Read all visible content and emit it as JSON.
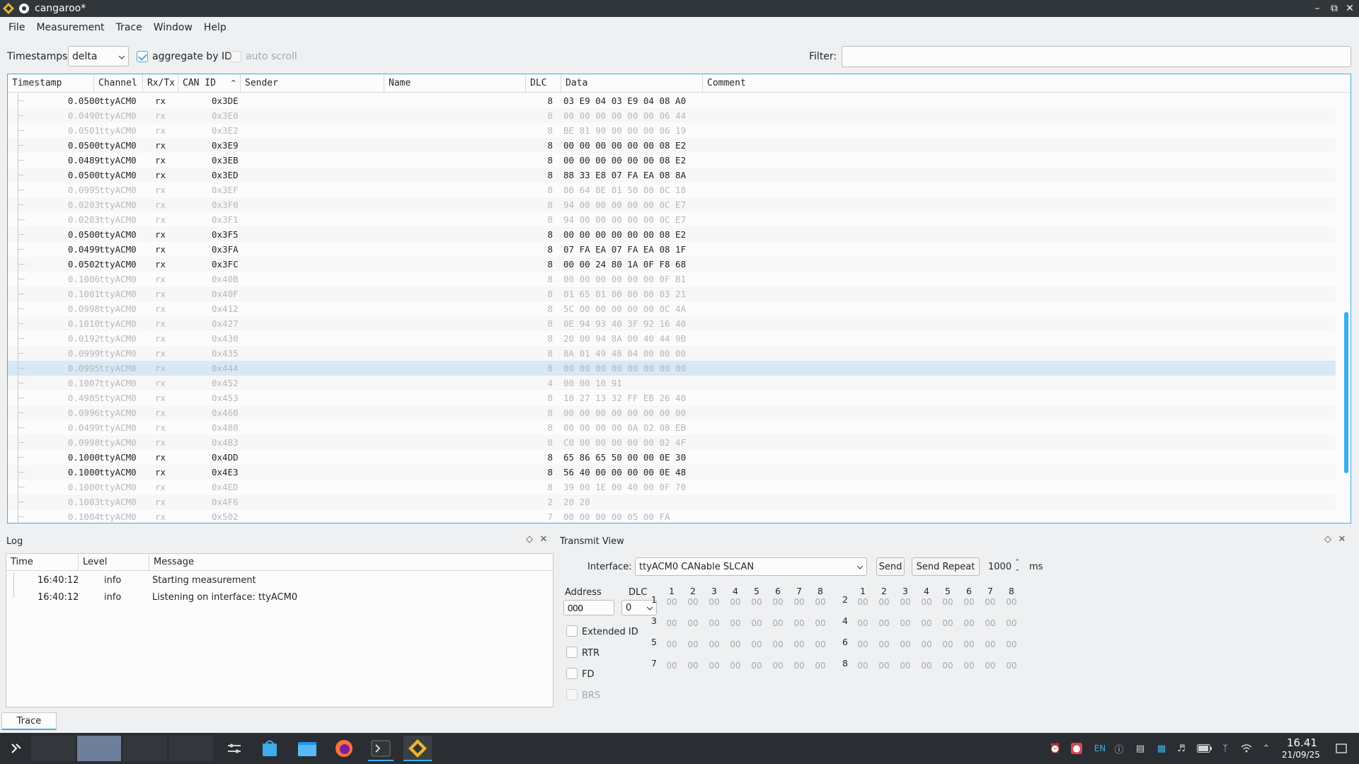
{
  "window": {
    "title": "cangaroo*"
  },
  "menu": [
    "File",
    "Measurement",
    "Trace",
    "Window",
    "Help"
  ],
  "toolbar": {
    "timestamps_label": "Timestamps:",
    "timestamps_value": "delta",
    "aggregate_label": "aggregate by ID",
    "aggregate_checked": true,
    "autoscroll_label": "auto scroll",
    "autoscroll_checked": false,
    "filter_label": "Filter:",
    "filter_value": ""
  },
  "trace": {
    "columns": [
      "Timestamp",
      "Channel",
      "Rx/Tx",
      "CAN ID",
      "Sender",
      "Name",
      "DLC",
      "Data",
      "Comment"
    ],
    "rows": [
      {
        "ts": "0.0500",
        "ch": "ttyACM0",
        "dir": "rx",
        "id": "0x3DE",
        "dlc": "8",
        "data": "03 E9 04 03 E9 04 08 A0",
        "dim": false
      },
      {
        "ts": "0.0490",
        "ch": "ttyACM0",
        "dir": "rx",
        "id": "0x3E0",
        "dlc": "8",
        "data": "00 00 00 00 00 00 06 44",
        "dim": true
      },
      {
        "ts": "0.0501",
        "ch": "ttyACM0",
        "dir": "rx",
        "id": "0x3E2",
        "dlc": "8",
        "data": "BE 81 90 00 00 00 06 19",
        "dim": true
      },
      {
        "ts": "0.0500",
        "ch": "ttyACM0",
        "dir": "rx",
        "id": "0x3E9",
        "dlc": "8",
        "data": "00 00 00 00 00 00 08 E2",
        "dim": false
      },
      {
        "ts": "0.0489",
        "ch": "ttyACM0",
        "dir": "rx",
        "id": "0x3EB",
        "dlc": "8",
        "data": "00 00 00 00 00 00 08 E2",
        "dim": false
      },
      {
        "ts": "0.0500",
        "ch": "ttyACM0",
        "dir": "rx",
        "id": "0x3ED",
        "dlc": "8",
        "data": "88 33 E8 07 FA EA 08 8A",
        "dim": false
      },
      {
        "ts": "0.0995",
        "ch": "ttyACM0",
        "dir": "rx",
        "id": "0x3EF",
        "dlc": "8",
        "data": "00 64 0E 01 50 00 0C 18",
        "dim": true
      },
      {
        "ts": "0.0203",
        "ch": "ttyACM0",
        "dir": "rx",
        "id": "0x3F0",
        "dlc": "8",
        "data": "94 00 00 00 00 00 0C E7",
        "dim": true
      },
      {
        "ts": "0.0203",
        "ch": "ttyACM0",
        "dir": "rx",
        "id": "0x3F1",
        "dlc": "8",
        "data": "94 00 00 00 00 00 0C E7",
        "dim": true
      },
      {
        "ts": "0.0500",
        "ch": "ttyACM0",
        "dir": "rx",
        "id": "0x3F5",
        "dlc": "8",
        "data": "00 00 00 00 00 00 08 E2",
        "dim": false
      },
      {
        "ts": "0.0499",
        "ch": "ttyACM0",
        "dir": "rx",
        "id": "0x3FA",
        "dlc": "8",
        "data": "07 FA EA 07 FA EA 08 1F",
        "dim": false
      },
      {
        "ts": "0.0502",
        "ch": "ttyACM0",
        "dir": "rx",
        "id": "0x3FC",
        "dlc": "8",
        "data": "00 00 24 80 1A 0F F8 68",
        "dim": false
      },
      {
        "ts": "0.1006",
        "ch": "ttyACM0",
        "dir": "rx",
        "id": "0x40B",
        "dlc": "8",
        "data": "00 00 00 00 00 00 0F B1",
        "dim": true
      },
      {
        "ts": "0.1001",
        "ch": "ttyACM0",
        "dir": "rx",
        "id": "0x40F",
        "dlc": "8",
        "data": "01 65 01 00 00 00 03 21",
        "dim": true
      },
      {
        "ts": "0.0998",
        "ch": "ttyACM0",
        "dir": "rx",
        "id": "0x412",
        "dlc": "8",
        "data": "5C 00 00 00 00 00 0C 4A",
        "dim": true
      },
      {
        "ts": "0.1010",
        "ch": "ttyACM0",
        "dir": "rx",
        "id": "0x427",
        "dlc": "8",
        "data": "0E 94 93 40 3F 92 16 40",
        "dim": true
      },
      {
        "ts": "0.0192",
        "ch": "ttyACM0",
        "dir": "rx",
        "id": "0x430",
        "dlc": "8",
        "data": "20 00 94 8A 00 40 44 9B",
        "dim": true
      },
      {
        "ts": "0.0999",
        "ch": "ttyACM0",
        "dir": "rx",
        "id": "0x435",
        "dlc": "8",
        "data": "8A 01 49 48 04 00 00 00",
        "dim": true
      },
      {
        "ts": "0.0995",
        "ch": "ttyACM0",
        "dir": "rx",
        "id": "0x444",
        "dlc": "8",
        "data": "00 00 00 00 00 00 00 00",
        "dim": true,
        "sel": true
      },
      {
        "ts": "0.1007",
        "ch": "ttyACM0",
        "dir": "rx",
        "id": "0x452",
        "dlc": "4",
        "data": "00 00 10 91",
        "dim": true
      },
      {
        "ts": "0.4985",
        "ch": "ttyACM0",
        "dir": "rx",
        "id": "0x453",
        "dlc": "8",
        "data": "10 27 13 32 FF EB 26 40",
        "dim": true
      },
      {
        "ts": "0.0996",
        "ch": "ttyACM0",
        "dir": "rx",
        "id": "0x460",
        "dlc": "8",
        "data": "00 00 00 00 00 00 00 00",
        "dim": true
      },
      {
        "ts": "0.0499",
        "ch": "ttyACM0",
        "dir": "rx",
        "id": "0x480",
        "dlc": "8",
        "data": "00 00 00 00 0A 02 08 EB",
        "dim": true
      },
      {
        "ts": "0.0998",
        "ch": "ttyACM0",
        "dir": "rx",
        "id": "0x4B3",
        "dlc": "8",
        "data": "C0 00 00 00 00 00 02 4F",
        "dim": true
      },
      {
        "ts": "0.1000",
        "ch": "ttyACM0",
        "dir": "rx",
        "id": "0x4DD",
        "dlc": "8",
        "data": "65 86 65 50 00 00 0E 30",
        "dim": false
      },
      {
        "ts": "0.1000",
        "ch": "ttyACM0",
        "dir": "rx",
        "id": "0x4E3",
        "dlc": "8",
        "data": "56 40 00 00 00 00 0E 48",
        "dim": false
      },
      {
        "ts": "0.1000",
        "ch": "ttyACM0",
        "dir": "rx",
        "id": "0x4ED",
        "dlc": "8",
        "data": "39 00 1E 00 40 00 0F 70",
        "dim": true
      },
      {
        "ts": "0.1003",
        "ch": "ttyACM0",
        "dir": "rx",
        "id": "0x4F6",
        "dlc": "2",
        "data": "20 20",
        "dim": true
      },
      {
        "ts": "0.1004",
        "ch": "ttyACM0",
        "dir": "rx",
        "id": "0x502",
        "dlc": "7",
        "data": "00 00 00 00 05 00 FA",
        "dim": true
      }
    ]
  },
  "log": {
    "title": "Log",
    "columns": [
      "Time",
      "Level",
      "Message"
    ],
    "rows": [
      {
        "time": "16:40:12",
        "level": "info",
        "message": "Starting measurement"
      },
      {
        "time": "16:40:12",
        "level": "info",
        "message": "Listening on interface: ttyACM0"
      }
    ]
  },
  "transmit": {
    "title": "Transmit View",
    "interface_label": "Interface:",
    "interface_value": "ttyACM0 CANable SLCAN",
    "send_label": "Send",
    "send_repeat_label": "Send Repeat",
    "repeat_value": "1000",
    "repeat_unit": "ms",
    "address_label": "Address",
    "address_value": "000",
    "dlc_label": "DLC",
    "dlc_value": "0",
    "extended_label": "Extended ID",
    "rtr_label": "RTR",
    "fd_label": "FD",
    "brs_label": "BRS",
    "col_numbers": [
      "1",
      "2",
      "3",
      "4",
      "5",
      "6",
      "7",
      "8"
    ],
    "row_numbers": [
      "1",
      "2",
      "3",
      "4",
      "5",
      "6",
      "7",
      "8"
    ],
    "byte_placeholder": "00"
  },
  "bottom_tab": "Trace",
  "taskbar": {
    "lang": "EN",
    "time": "16.41",
    "date": "21/09/25"
  },
  "colors": {
    "accent": "#3daee9",
    "titlebar": "#31363b",
    "taskbar": "#2a2e32",
    "selection": "#d6e9f5"
  }
}
